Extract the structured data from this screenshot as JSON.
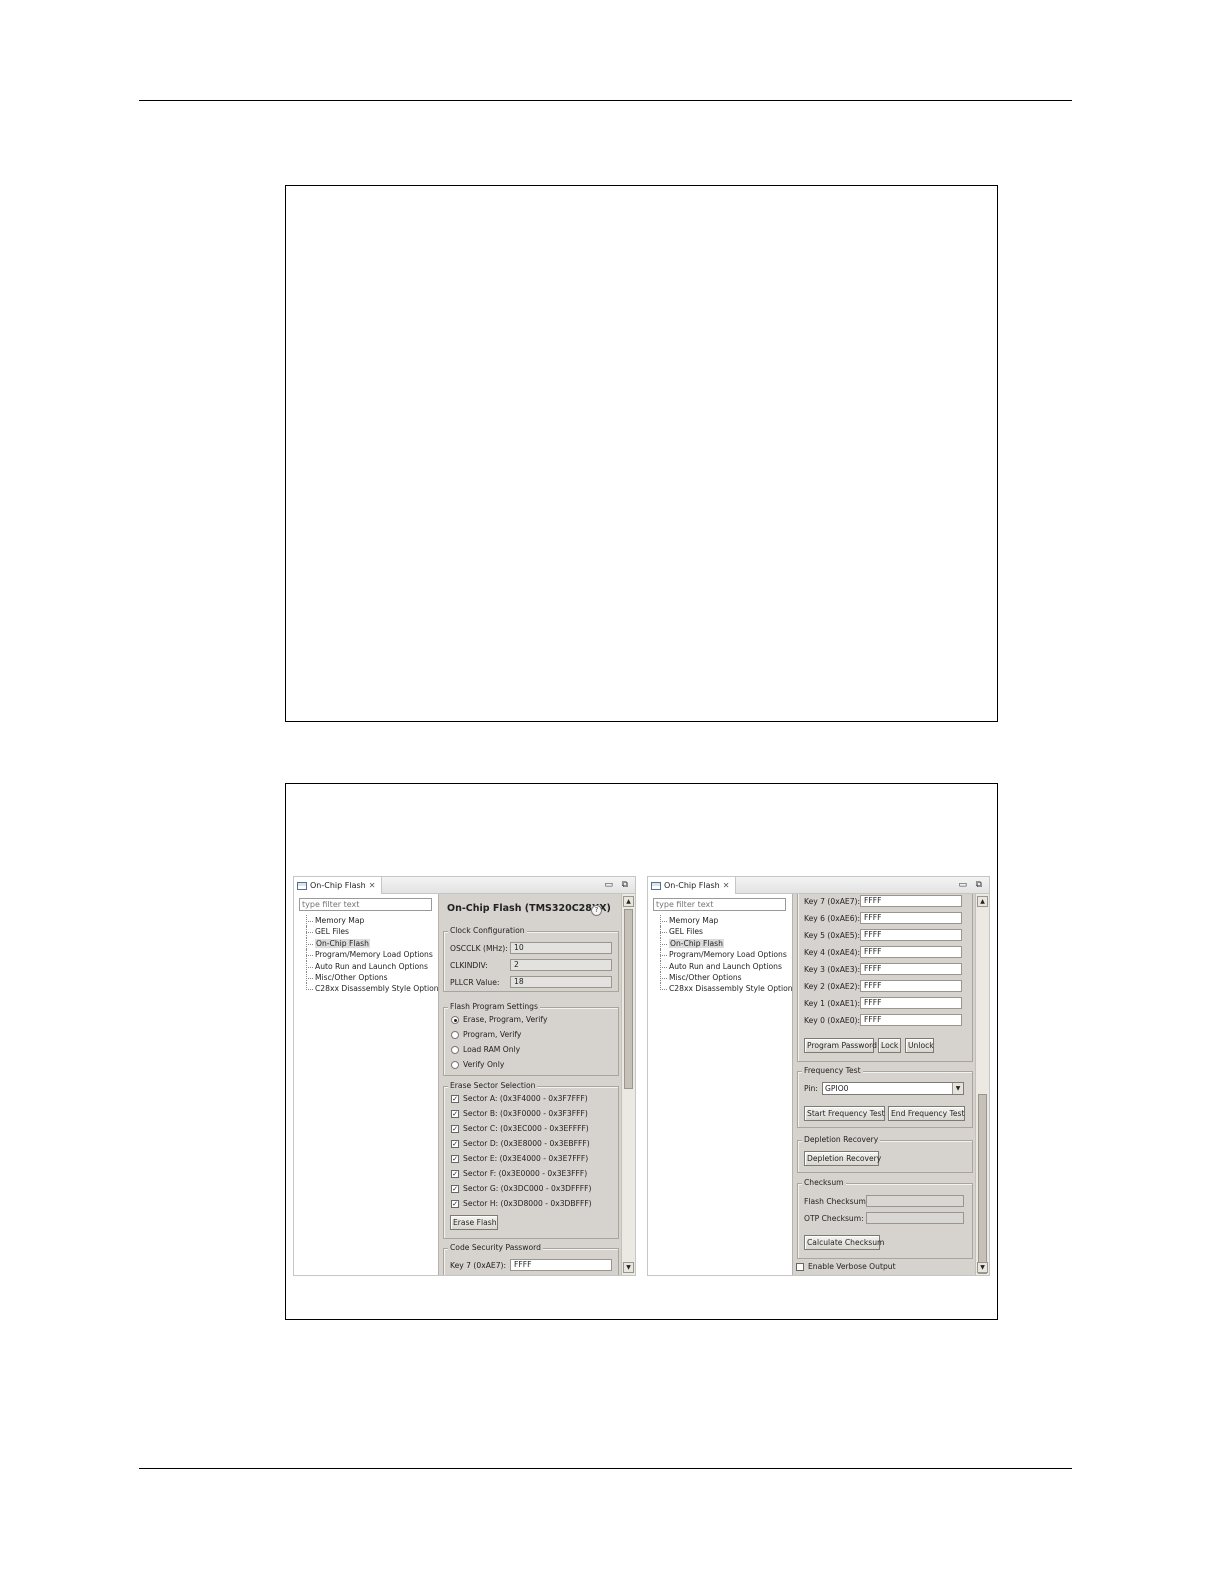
{
  "views": [
    {
      "tab_title": "On-Chip Flash",
      "filter_placeholder": "type filter text",
      "tree": [
        "Memory Map",
        "GEL Files",
        "On-Chip Flash",
        "Program/Memory Load Options",
        "Auto Run and Launch Options",
        "Misc/Other Options",
        "C28xx Disassembly Style Options"
      ],
      "selected_tree_item": "On-Chip Flash",
      "panel_title": "On-Chip Flash (TMS320C28XX)",
      "clock": {
        "legend": "Clock Configuration",
        "rows": [
          {
            "label": "OSCCLK (MHz):",
            "value": "10"
          },
          {
            "label": "CLKINDIV:",
            "value": "2"
          },
          {
            "label": "PLLCR Value:",
            "value": "18"
          }
        ]
      },
      "program_setting": {
        "legend": "Flash Program Settings",
        "options": [
          "Erase, Program, Verify",
          "Program, Verify",
          "Load RAM Only",
          "Verify Only"
        ],
        "selected": "Erase, Program, Verify"
      },
      "erase": {
        "legend": "Erase Sector Selection",
        "sectors": [
          "Sector A: (0x3F4000 - 0x3F7FFF)",
          "Sector B: (0x3F0000 - 0x3F3FFF)",
          "Sector C: (0x3EC000 - 0x3EFFFF)",
          "Sector D: (0x3E8000 - 0x3EBFFF)",
          "Sector E: (0x3E4000 - 0x3E7FFF)",
          "Sector F: (0x3E0000 - 0x3E3FFF)",
          "Sector G: (0x3DC000 - 0x3DFFFF)",
          "Sector H: (0x3D8000 - 0x3DBFFF)"
        ],
        "checked": [
          true,
          true,
          true,
          true,
          true,
          true,
          true,
          true
        ],
        "button": "Erase Flash"
      },
      "password": {
        "legend": "Code Security Password",
        "first_key_label": "Key 7 (0xAE7):",
        "first_key_value": "FFFF"
      }
    },
    {
      "tab_title": "On-Chip Flash",
      "filter_placeholder": "type filter text",
      "tree": [
        "Memory Map",
        "GEL Files",
        "On-Chip Flash",
        "Program/Memory Load Options",
        "Auto Run and Launch Options",
        "Misc/Other Options",
        "C28xx Disassembly Style Options"
      ],
      "selected_tree_item": "On-Chip Flash",
      "keys": [
        {
          "label": "Key 7 (0xAE7):",
          "value": "FFFF"
        },
        {
          "label": "Key 6 (0xAE6):",
          "value": "FFFF"
        },
        {
          "label": "Key 5 (0xAE5):",
          "value": "FFFF"
        },
        {
          "label": "Key 4 (0xAE4):",
          "value": "FFFF"
        },
        {
          "label": "Key 3 (0xAE3):",
          "value": "FFFF"
        },
        {
          "label": "Key 2 (0xAE2):",
          "value": "FFFF"
        },
        {
          "label": "Key 1 (0xAE1):",
          "value": "FFFF"
        },
        {
          "label": "Key 0 (0xAE0):",
          "value": "FFFF"
        }
      ],
      "key_buttons": [
        "Program Password",
        "Lock",
        "Unlock"
      ],
      "frequency": {
        "legend": "Frequency Test",
        "pin_label": "Pin:",
        "pin_value": "GPIO0",
        "start_button": "Start Frequency Test",
        "end_button": "End Frequency Test"
      },
      "depletion": {
        "legend": "Depletion Recovery",
        "button": "Depletion Recovery"
      },
      "checksum": {
        "legend": "Checksum",
        "flash_label": "Flash Checksum:",
        "otp_label": "OTP Checksum:",
        "button": "Calculate Checksum"
      },
      "verbose_label": "Enable Verbose Output",
      "verbose_checked": false
    }
  ],
  "icons": {
    "close": "close-icon",
    "minimize": "minimize-icon",
    "maximize": "maximize-icon",
    "help": "help-icon",
    "tab": "view-tab-icon"
  }
}
